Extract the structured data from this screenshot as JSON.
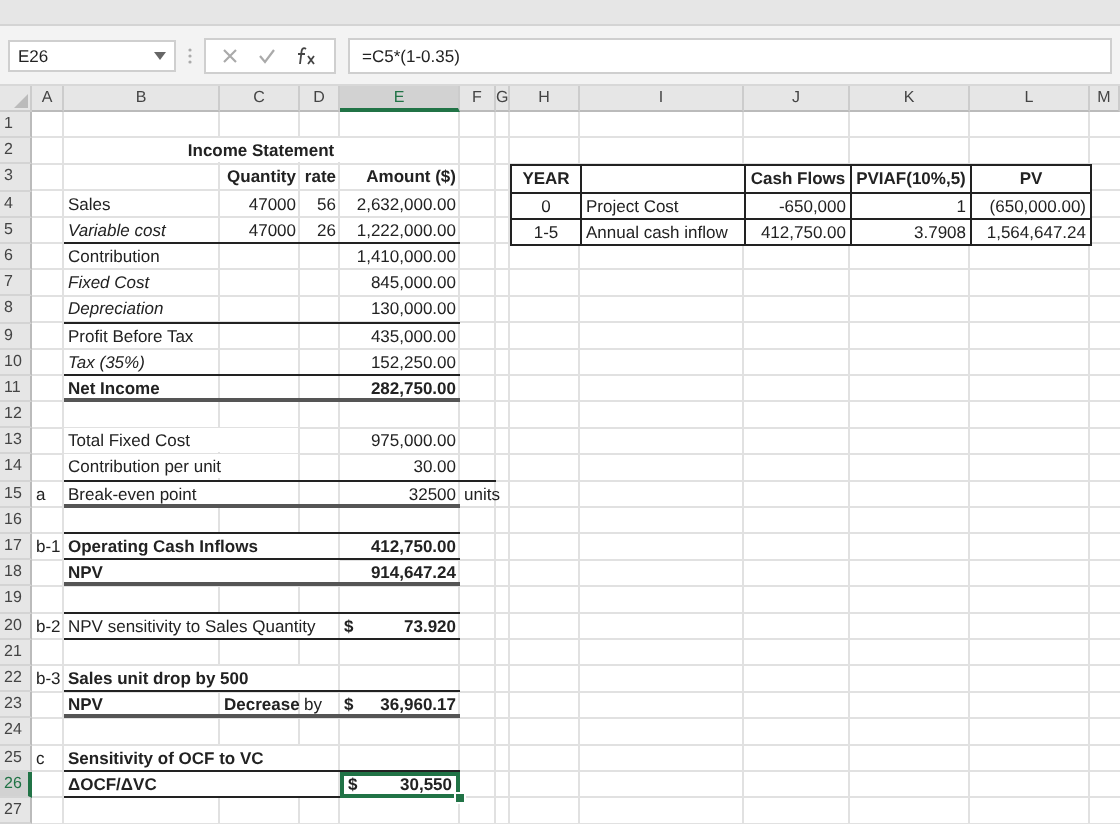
{
  "name_box": "E26",
  "formula": "=C5*(1-0.35)",
  "columns": [
    {
      "label": "A",
      "selected": false
    },
    {
      "label": "B",
      "selected": false
    },
    {
      "label": "C",
      "selected": false
    },
    {
      "label": "D",
      "selected": false
    },
    {
      "label": "E",
      "selected": true
    },
    {
      "label": "F",
      "selected": false
    },
    {
      "label": "G",
      "selected": false
    },
    {
      "label": "H",
      "selected": false
    },
    {
      "label": "I",
      "selected": false
    },
    {
      "label": "J",
      "selected": false
    },
    {
      "label": "K",
      "selected": false
    },
    {
      "label": "L",
      "selected": false
    },
    {
      "label": "M",
      "selected": false
    }
  ],
  "row_numbers": [
    {
      "label": "1",
      "selected": false
    },
    {
      "label": "2",
      "selected": false
    },
    {
      "label": "3",
      "selected": false
    },
    {
      "label": "4",
      "selected": false
    },
    {
      "label": "5",
      "selected": false
    },
    {
      "label": "6",
      "selected": false
    },
    {
      "label": "7",
      "selected": false
    },
    {
      "label": "8",
      "selected": false
    },
    {
      "label": "9",
      "selected": false
    },
    {
      "label": "10",
      "selected": false
    },
    {
      "label": "11",
      "selected": false
    },
    {
      "label": "12",
      "selected": false
    },
    {
      "label": "13",
      "selected": false
    },
    {
      "label": "14",
      "selected": false
    },
    {
      "label": "15",
      "selected": false
    },
    {
      "label": "16",
      "selected": false
    },
    {
      "label": "17",
      "selected": false
    },
    {
      "label": "18",
      "selected": false
    },
    {
      "label": "19",
      "selected": false
    },
    {
      "label": "20",
      "selected": false
    },
    {
      "label": "21",
      "selected": false
    },
    {
      "label": "22",
      "selected": false
    },
    {
      "label": "23",
      "selected": false
    },
    {
      "label": "24",
      "selected": false
    },
    {
      "label": "25",
      "selected": false
    },
    {
      "label": "26",
      "selected": true
    },
    {
      "label": "27",
      "selected": false
    }
  ],
  "income_statement": {
    "title": "Income Statement",
    "headers": {
      "quantity": "Quantity",
      "rate": "rate",
      "amount": "Amount ($)"
    },
    "lines": [
      {
        "label": "Sales",
        "quantity": "47000",
        "rate": "56",
        "amount": "2,632,000.00"
      },
      {
        "label": "Variable cost",
        "quantity": "47000",
        "rate": "26",
        "amount": "1,222,000.00"
      },
      {
        "label": "Contribution",
        "amount": "1,410,000.00"
      },
      {
        "label": "Fixed Cost",
        "amount": "845,000.00"
      },
      {
        "label": "Depreciation",
        "amount": "130,000.00"
      },
      {
        "label": "Profit Before Tax",
        "amount": "435,000.00"
      },
      {
        "label": "Tax (35%)",
        "amount": "152,250.00"
      },
      {
        "label": "Net Income",
        "amount": "282,750.00"
      }
    ]
  },
  "break_even": [
    {
      "label": "Total Fixed Cost",
      "amount": "975,000.00"
    },
    {
      "label": "Contribution per unit",
      "amount": "30.00"
    },
    {
      "part": "a",
      "label": "Break-even point",
      "amount": "32500",
      "unit": "units"
    }
  ],
  "answers": [
    {
      "part": "b-1",
      "label": "Operating Cash Inflows",
      "amount": "412,750.00",
      "selected": false
    },
    {
      "label": "NPV",
      "amount": "914,647.24",
      "selected": false
    },
    {
      "part": "b-2",
      "label": "NPV sensitivity to Sales Quantity",
      "currency": "$",
      "amount": "73.920",
      "selected": false
    },
    {
      "part": "b-3",
      "label": "Sales unit drop by 500",
      "selected": false
    },
    {
      "label": "NPV",
      "change": "Decrease",
      "by": "by",
      "currency": "$",
      "amount": "36,960.17",
      "selected": false
    },
    {
      "part": "c",
      "label": "Sensitivity of OCF to VC",
      "selected": false
    },
    {
      "label": "ΔOCF/ΔVC",
      "currency": "$",
      "amount": "30,550",
      "selected": true
    }
  ],
  "pv_table": {
    "header": {
      "year": "YEAR",
      "cash_flows": "Cash Flows",
      "factor": "PVIAF(10%,5)",
      "pv": "PV"
    },
    "rows": [
      {
        "year": "0",
        "item": "Project Cost",
        "cash_flow": "-650,000",
        "factor": "1",
        "pv": "(650,000.00)"
      },
      {
        "year": "1-5",
        "item": "Annual cash inflow",
        "cash_flow": "412,750.00",
        "factor": "3.7908",
        "pv": "1,564,647.24"
      }
    ]
  }
}
